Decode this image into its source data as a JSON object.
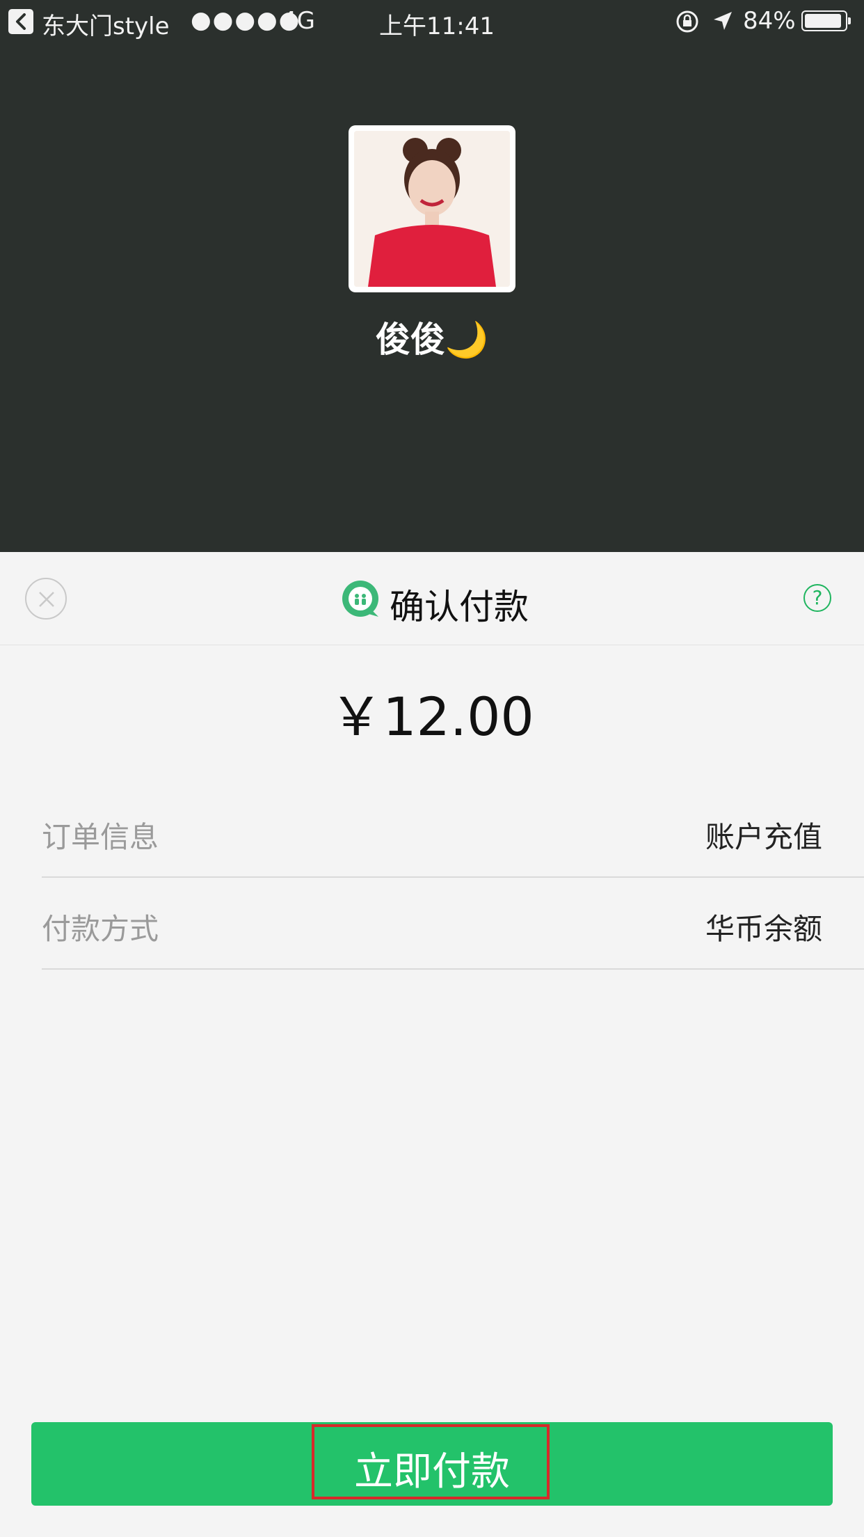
{
  "status_bar": {
    "carrier": "东大门style",
    "signal": "●●●●●",
    "network": "4G",
    "time": "上午11:41",
    "battery": "84%",
    "battery_level": 0.84
  },
  "profile": {
    "name": "俊俊🌙"
  },
  "payment": {
    "title": "确认付款",
    "help": "?",
    "amount": "￥12.00",
    "rows": [
      {
        "label": "订单信息",
        "value": "账户充值"
      },
      {
        "label": "付款方式",
        "value": "华币余额"
      }
    ],
    "pay_button": "立即付款"
  },
  "colors": {
    "header_bg": "#2b302d",
    "accent_green": "#23c26a",
    "highlight_red": "#d62a2a"
  }
}
